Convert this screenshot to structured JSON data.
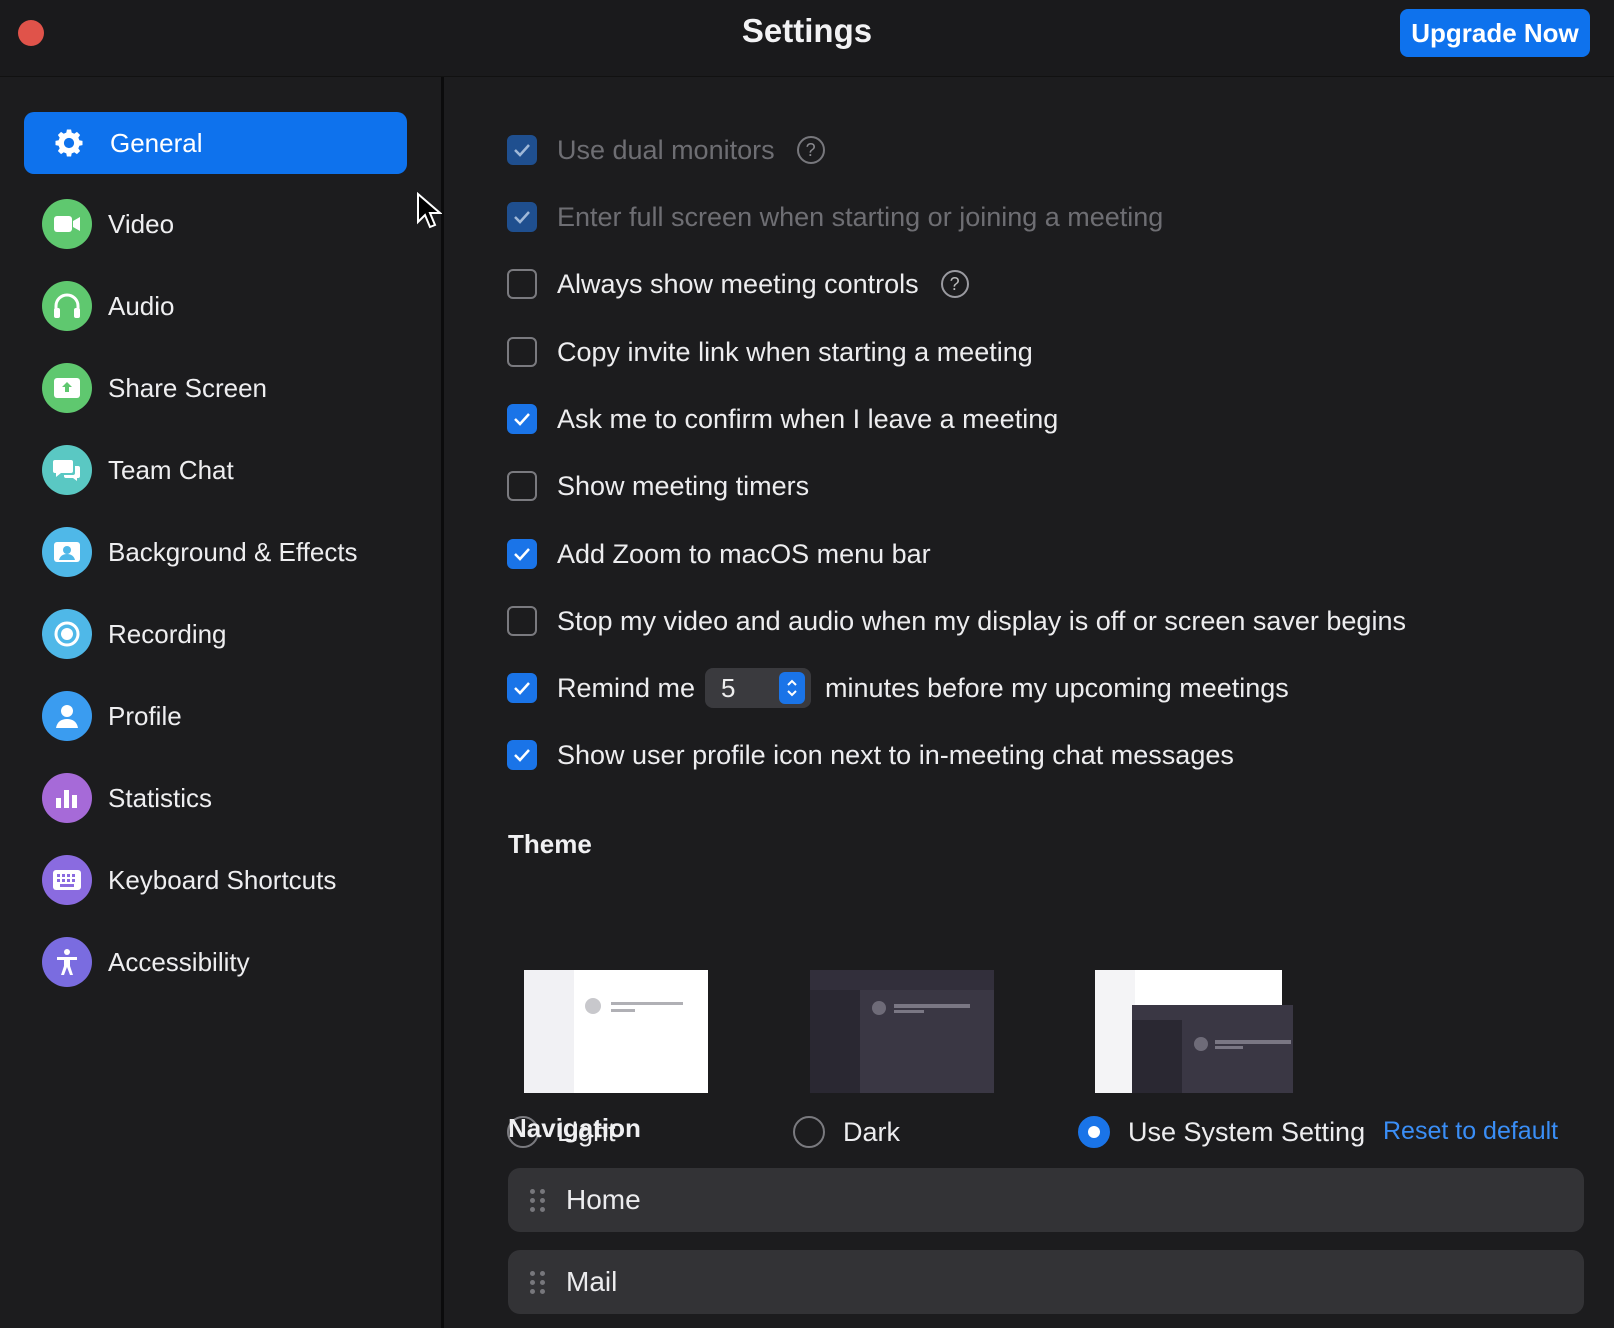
{
  "window": {
    "title": "Settings",
    "upgrade_label": "Upgrade Now"
  },
  "sidebar": {
    "items": [
      {
        "label": "General",
        "icon": "gear-icon",
        "color": "#0e72ed",
        "active": true
      },
      {
        "label": "Video",
        "icon": "video-camera-icon",
        "color": "#5fc86f"
      },
      {
        "label": "Audio",
        "icon": "headphones-icon",
        "color": "#5fc86f"
      },
      {
        "label": "Share Screen",
        "icon": "share-screen-icon",
        "color": "#5fc86f"
      },
      {
        "label": "Team Chat",
        "icon": "chat-bubbles-icon",
        "color": "#5ac8c3"
      },
      {
        "label": "Background & Effects",
        "icon": "person-background-icon",
        "color": "#4fb8e8"
      },
      {
        "label": "Recording",
        "icon": "record-icon",
        "color": "#4fb8e8"
      },
      {
        "label": "Profile",
        "icon": "profile-icon",
        "color": "#3a9cf0"
      },
      {
        "label": "Statistics",
        "icon": "bar-chart-icon",
        "color": "#a66ad8"
      },
      {
        "label": "Keyboard Shortcuts",
        "icon": "keyboard-icon",
        "color": "#8a6be0"
      },
      {
        "label": "Accessibility",
        "icon": "accessibility-icon",
        "color": "#7a6ce0"
      }
    ]
  },
  "general": {
    "options": [
      {
        "label": "Use dual monitors",
        "checked": true,
        "disabled": true,
        "help": true
      },
      {
        "label": "Enter full screen when starting or joining a meeting",
        "checked": true,
        "disabled": true
      },
      {
        "label": "Always show meeting controls",
        "checked": false,
        "help": true
      },
      {
        "label": "Copy invite link when starting a meeting",
        "checked": false
      },
      {
        "label": "Ask me to confirm when I leave a meeting",
        "checked": true
      },
      {
        "label": "Show meeting timers",
        "checked": false
      },
      {
        "label": "Add Zoom to macOS menu bar",
        "checked": true
      },
      {
        "label": "Stop my video and audio when my display is off or screen saver begins",
        "checked": false
      }
    ],
    "remind": {
      "checked": true,
      "prefix": "Remind me",
      "value": "5",
      "suffix": "minutes before my upcoming meetings"
    },
    "profile_icon_option": {
      "label": "Show user profile icon next to in-meeting chat messages",
      "checked": true
    },
    "help_glyph": "?"
  },
  "theme": {
    "title": "Theme",
    "options": [
      {
        "label": "Light",
        "selected": false
      },
      {
        "label": "Dark",
        "selected": false
      },
      {
        "label": "Use System Setting",
        "selected": true
      }
    ]
  },
  "navigation": {
    "title": "Navigation",
    "reset_label": "Reset to default",
    "items": [
      "Home",
      "Mail"
    ]
  },
  "colors": {
    "accent": "#0e72ed",
    "link": "#3a8ef6",
    "close": "#e0534a"
  }
}
